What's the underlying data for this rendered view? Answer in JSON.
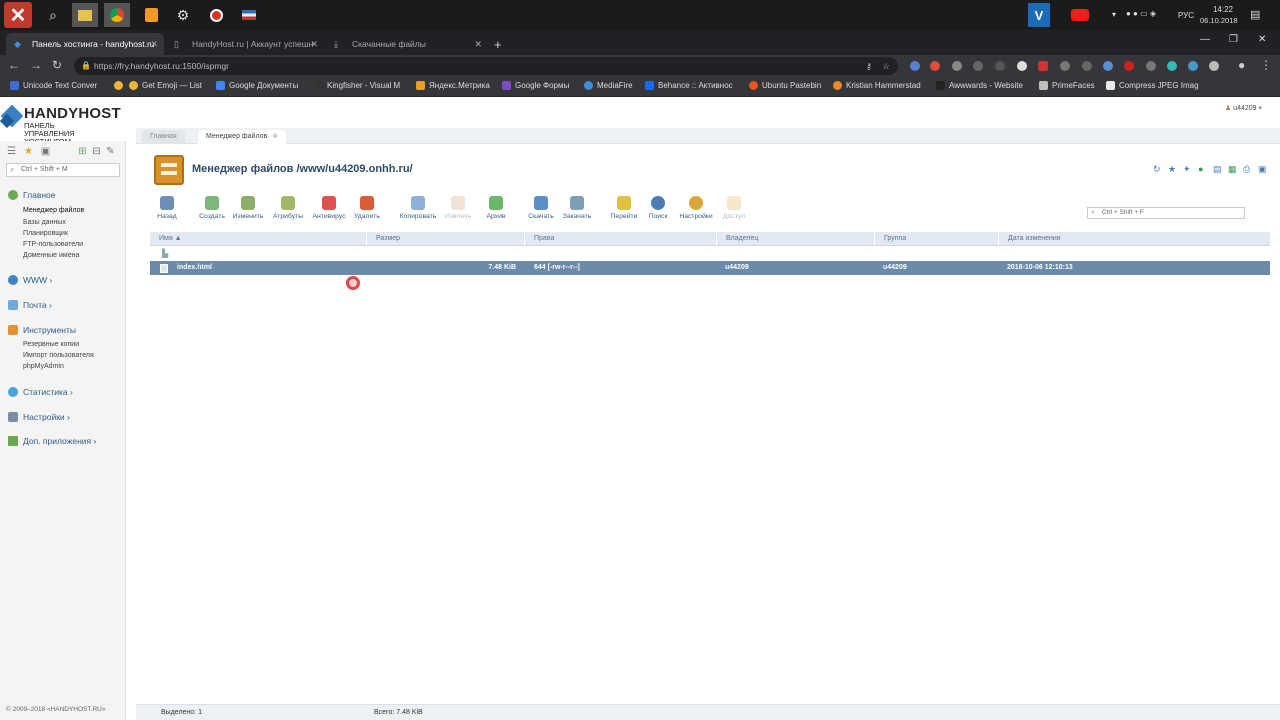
{
  "taskbar": {
    "clock_time": "14:22",
    "clock_date": "06.10.2018",
    "lang": "РУС"
  },
  "browser": {
    "tabs": [
      {
        "label": "Панель хостинга - handyhost.ru",
        "active": true
      },
      {
        "label": "HandyHost.ru | Аккаунт успешн",
        "active": false
      },
      {
        "label": "Скачанные файлы",
        "active": false
      }
    ],
    "url": "https://fry.handyhost.ru:1500/ispmgr",
    "bookmarks": [
      {
        "label": "Unicode Text Conver",
        "color": "#3a6fd8"
      },
      {
        "label": "Get Emoji — List",
        "color": "#f2b632"
      },
      {
        "label": "Get Emoji — List",
        "color": "#f2b632"
      },
      {
        "label": "Google Документы",
        "color": "#4285f4"
      },
      {
        "label": "Kingfisher - Visual M",
        "color": "#333333"
      },
      {
        "label": "Яндекс.Метрика",
        "color": "#e5a12b"
      },
      {
        "label": "Google Формы",
        "color": "#7b4bc4"
      },
      {
        "label": "MediaFire",
        "color": "#3a8fd8"
      },
      {
        "label": "Behance :: Активнос",
        "color": "#1769ff"
      },
      {
        "label": "Ubuntu Pastebin",
        "color": "#e95420"
      },
      {
        "label": "Kristian Hammerstad",
        "color": "#f08a24"
      },
      {
        "label": "Awwwards - Website",
        "color": "#222222"
      },
      {
        "label": "PrimeFaces",
        "color": "#c0c0c0"
      },
      {
        "label": "Compress JPEG Imag",
        "color": "#e8e8e8"
      }
    ]
  },
  "panel": {
    "logo_name": "HANDYHOST",
    "logo_sub": "ПАНЕЛЬ УПРАВЛЕНИЯ ХОСТИНГОМ",
    "user": "u44209",
    "sidebar_search": "Ctrl + Shift + M",
    "groups": [
      {
        "label": "Главное",
        "color": "#6aa84f",
        "items": [
          "Менеджер файлов",
          "Базы данных",
          "Планировщик",
          "FTP-пользователи",
          "Доменные имена"
        ]
      },
      {
        "label": "WWW ›",
        "color": "#3d85c6",
        "items": []
      },
      {
        "label": "Почта ›",
        "color": "#6fa8dc",
        "items": []
      },
      {
        "label": "Инструменты",
        "color": "#e69138",
        "items": [
          "Резервные копии",
          "Импорт пользователя",
          "phpMyAdmin"
        ]
      },
      {
        "label": "Статистика ›",
        "color": "#45a5d8",
        "items": []
      },
      {
        "label": "Настройки ›",
        "color": "#7a8ea3",
        "items": []
      },
      {
        "label": "Доп. приложения ›",
        "color": "#6aa84f",
        "items": []
      }
    ],
    "copyright": "© 2009–2018 «HANDYHOST.RU»",
    "page_tabs": [
      {
        "label": "Главная",
        "active": false
      },
      {
        "label": "Менеджер файлов",
        "active": true
      }
    ],
    "page_title": "Менеджер файлов /www/u44209.onhh.ru/",
    "toolbar": [
      {
        "label": "Назад",
        "color": "#6b8fb8",
        "disabled": false
      },
      {
        "label": "Создать",
        "color": "#7cb87a",
        "disabled": false
      },
      {
        "label": "Изменить",
        "color": "#8fae6b",
        "disabled": false
      },
      {
        "label": "Атрибуты",
        "color": "#a3b86b",
        "disabled": false
      },
      {
        "label": "Антивирус",
        "color": "#e05050",
        "disabled": false
      },
      {
        "label": "Удалить",
        "color": "#d85b3a",
        "disabled": false
      },
      {
        "label": "Копировать",
        "color": "#8fb0d8",
        "disabled": false
      },
      {
        "label": "Извлечь",
        "color": "#d8b08f",
        "disabled": true
      },
      {
        "label": "Архив",
        "color": "#6bb86b",
        "disabled": false
      },
      {
        "label": "Скачать",
        "color": "#5b8fc8",
        "disabled": false
      },
      {
        "label": "Закачать",
        "color": "#7ba0b8",
        "disabled": false
      },
      {
        "label": "Перейти",
        "color": "#e0c040",
        "disabled": false
      },
      {
        "label": "Поиск",
        "color": "#4a7db5",
        "disabled": false
      },
      {
        "label": "Настройки",
        "color": "#d8a83a",
        "disabled": false
      },
      {
        "label": "Доступ",
        "color": "#e0c060",
        "disabled": true
      }
    ],
    "filter_placeholder": "Ctrl + Shift + F",
    "columns": [
      "Имя ▲",
      "Размер",
      "Права",
      "Владелец",
      "Группа",
      "Дата изменения"
    ],
    "rows": [
      {
        "name": "index.html",
        "size": "7.48 KiB",
        "perms": "644 [-rw-r--r--]",
        "owner": "u44209",
        "group": "u44209",
        "modified": "2018-10-06 12:10:13"
      }
    ],
    "status_selected": "Выделено: 1",
    "status_total": "Всего: 7.48 KiB"
  }
}
